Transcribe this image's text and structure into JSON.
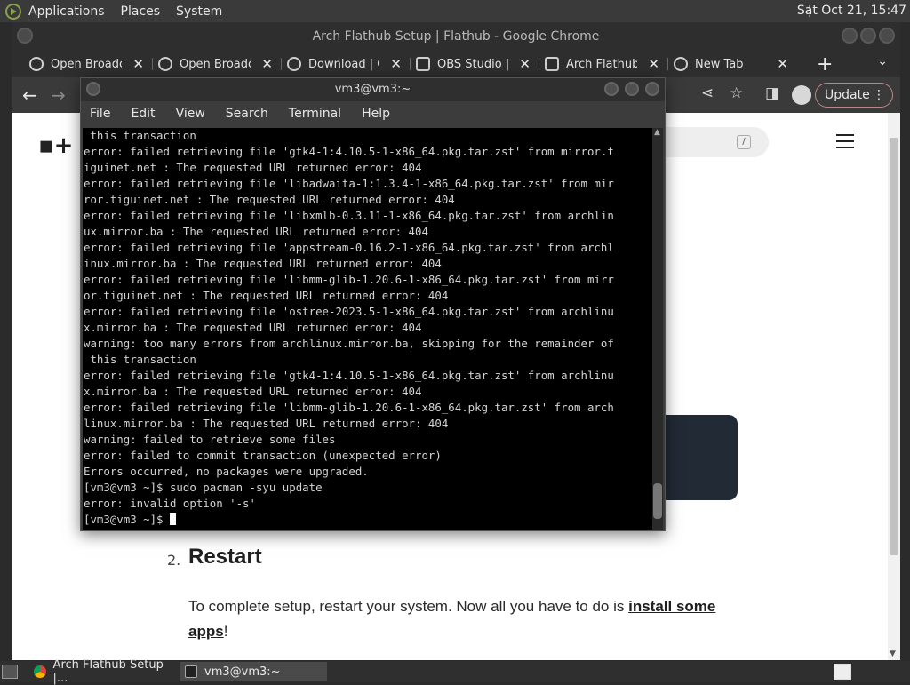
{
  "top_panel": {
    "menus": [
      "Applications",
      "Places",
      "System"
    ],
    "clock": "Sat Oct 21, 15:47"
  },
  "chrome": {
    "window_title": "Arch Flathub Setup | Flathub - Google Chrome",
    "tabs": [
      {
        "label": "Open Broadca",
        "icon": "obs-icon"
      },
      {
        "label": "Open Broadca",
        "icon": "obs-icon"
      },
      {
        "label": "Download | O",
        "icon": "obs-icon"
      },
      {
        "label": "OBS Studio | F",
        "icon": "flathub-icon"
      },
      {
        "label": "Arch Flathub",
        "icon": "flathub-icon"
      },
      {
        "label": "New Tab",
        "icon": "chrome-icon"
      }
    ],
    "update_label": "Update",
    "search_key": "/",
    "page": {
      "step_number": "2.",
      "step_title": "Restart",
      "step_text_before": "To complete setup, restart your system. Now all you have to do is ",
      "step_link": "install some apps",
      "step_text_after": "!"
    }
  },
  "terminal": {
    "title": "vm3@vm3:~",
    "menu": [
      "File",
      "Edit",
      "View",
      "Search",
      "Terminal",
      "Help"
    ],
    "lines": [
      " this transaction",
      "error: failed retrieving file 'gtk4-1:4.10.5-1-x86_64.pkg.tar.zst' from mirror.t",
      "iguinet.net : The requested URL returned error: 404",
      "error: failed retrieving file 'libadwaita-1:1.3.4-1-x86_64.pkg.tar.zst' from mir",
      "ror.tiguinet.net : The requested URL returned error: 404",
      "error: failed retrieving file 'libxmlb-0.3.11-1-x86_64.pkg.tar.zst' from archlin",
      "ux.mirror.ba : The requested URL returned error: 404",
      "error: failed retrieving file 'appstream-0.16.2-1-x86_64.pkg.tar.zst' from archl",
      "inux.mirror.ba : The requested URL returned error: 404",
      "error: failed retrieving file 'libmm-glib-1.20.6-1-x86_64.pkg.tar.zst' from mirr",
      "or.tiguinet.net : The requested URL returned error: 404",
      "error: failed retrieving file 'ostree-2023.5-1-x86_64.pkg.tar.zst' from archlinu",
      "x.mirror.ba : The requested URL returned error: 404",
      "warning: too many errors from archlinux.mirror.ba, skipping for the remainder of",
      " this transaction",
      "error: failed retrieving file 'gtk4-1:4.10.5-1-x86_64.pkg.tar.zst' from archlinu",
      "x.mirror.ba : The requested URL returned error: 404",
      "error: failed retrieving file 'libmm-glib-1.20.6-1-x86_64.pkg.tar.zst' from arch",
      "linux.mirror.ba : The requested URL returned error: 404",
      "warning: failed to retrieve some files",
      "error: failed to commit transaction (unexpected error)",
      "Errors occurred, no packages were upgraded.",
      "[vm3@vm3 ~]$ sudo pacman -syu update",
      "error: invalid option '-s'"
    ],
    "prompt": "[vm3@vm3 ~]$ "
  },
  "taskbar": {
    "tasks": [
      {
        "label": "Arch Flathub Setup |...",
        "icon": "chrome-icon"
      },
      {
        "label": "vm3@vm3:~",
        "icon": "terminal-icon"
      }
    ]
  }
}
